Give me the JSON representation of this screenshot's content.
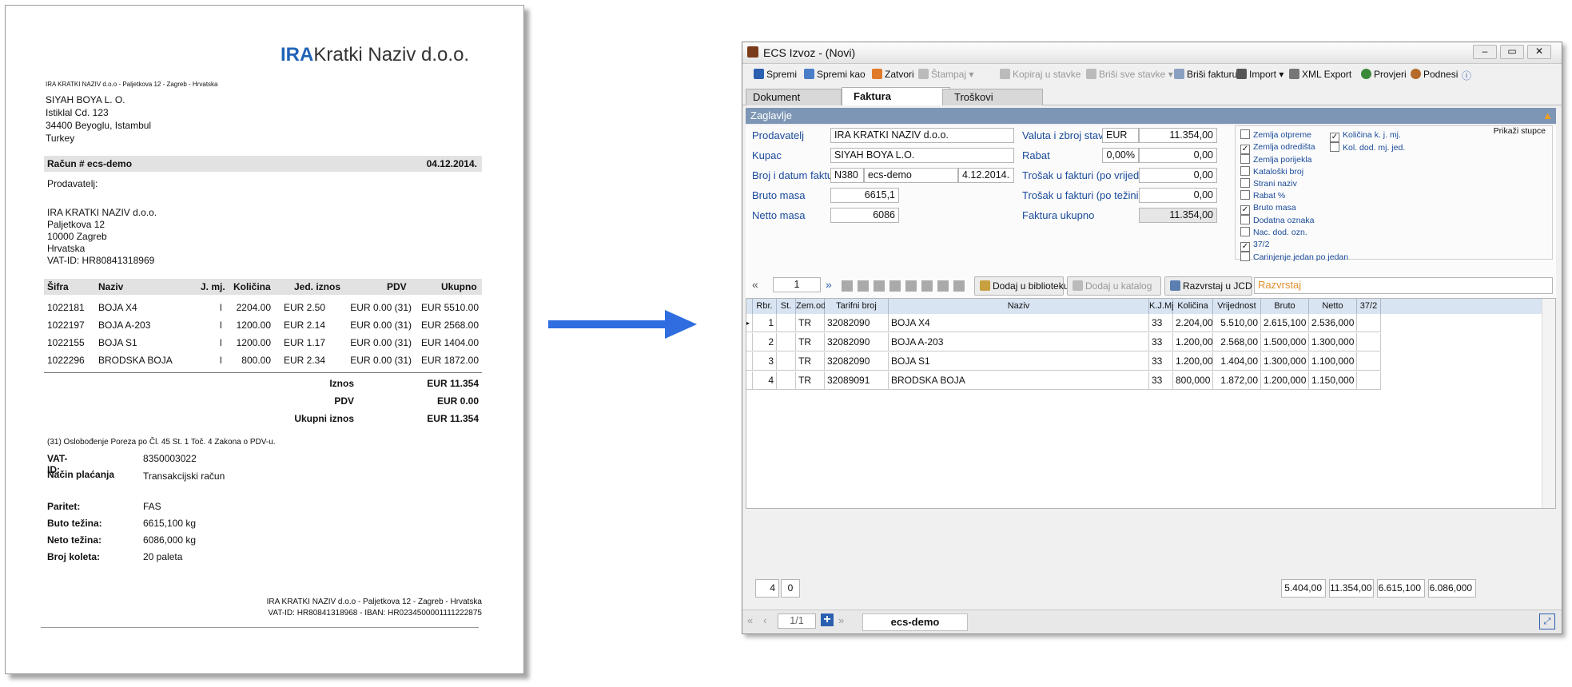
{
  "invoice": {
    "logo_bold": "IRA",
    "logo_rest": "Kratki Naziv d.o.o.",
    "sender_line": "IRA KRATKI NAZIV d.o.o - Paljetkova 12 - Zagreb - Hrvatska",
    "recipient": [
      "SIYAH BOYA L. O.",
      "Istiklal Cd. 123",
      "34400 Beyoglu, Istambul",
      "Turkey"
    ],
    "title": "Račun # ecs-demo",
    "date": "04.12.2014.",
    "seller_label": "Prodavatelj:",
    "seller": [
      "IRA KRATKI NAZIV d.o.o.",
      "Paljetkova 12",
      "10000 Zagreb",
      "Hrvatska",
      "VAT-ID: HR80841318969"
    ],
    "table_headers": [
      "Šifra",
      "Naziv",
      "J. mj.",
      "Količina",
      "Jed. iznos",
      "PDV",
      "Ukupno"
    ],
    "rows": [
      [
        "1022181",
        "BOJA X4",
        "l",
        "2204.00",
        "EUR 2.50",
        "EUR 0.00 (31)",
        "EUR 5510.00"
      ],
      [
        "1022197",
        "BOJA A-203",
        "l",
        "1200.00",
        "EUR 2.14",
        "EUR 0.00 (31)",
        "EUR 2568.00"
      ],
      [
        "1022155",
        "BOJA S1",
        "l",
        "1200.00",
        "EUR 1.17",
        "EUR 0.00 (31)",
        "EUR 1404.00"
      ],
      [
        "1022296",
        "BRODSKA BOJA",
        "l",
        "800.00",
        "EUR 2.34",
        "EUR 0.00 (31)",
        "EUR 1872.00"
      ]
    ],
    "totals": [
      {
        "label": "Iznos",
        "value": "EUR 11.354"
      },
      {
        "label": "PDV",
        "value": "EUR 0.00"
      },
      {
        "label": "Ukupni iznos",
        "value": "EUR 11.354"
      }
    ],
    "note": "(31) Oslobođenje Poreza po Čl. 45 St. 1 Toč. 4 Zakona o PDV-u.",
    "info1": [
      {
        "label": "VAT-ID:",
        "value": "8350003022"
      },
      {
        "label": "Način plaćanja",
        "value": "Transakcijski račun"
      }
    ],
    "info2": [
      {
        "label": "Paritet:",
        "value": "FAS"
      },
      {
        "label": "Buto težina:",
        "value": "6615,100 kg"
      },
      {
        "label": "Neto težina:",
        "value": "6086,000 kg"
      },
      {
        "label": "Broj koleta:",
        "value": "20 paleta"
      }
    ],
    "footer1": "IRA KRATKI NAZIV d.o.o - Paljetkova 12 - Zagreb - Hrvatska",
    "footer2": "VAT-ID: HR80841318968 - IBAN: HR0234500001111222875"
  },
  "window": {
    "title": "ECS Izvoz - (Novi)",
    "toolbar": {
      "save": "Spremi",
      "save_as": "Spremi kao",
      "close": "Zatvori",
      "print": "Štampaj",
      "copy_to_items": "Kopiraj u stavke",
      "delete_all": "Briši sve stavke",
      "delete_invoice": "Briši fakturu",
      "import": "Import",
      "xml_export": "XML Export",
      "check": "Provjeri",
      "submit": "Podnesi"
    },
    "tabs": [
      "Dokument",
      "Faktura",
      "Troškovi"
    ],
    "section_title": "Zaglavlje",
    "form": {
      "seller_label": "Prodavatelj",
      "seller_value": "IRA KRATKI NAZIV d.o.o.",
      "buyer_label": "Kupac",
      "buyer_value": "SIYAH BOYA L.O.",
      "number_label": "Broj i datum fakture",
      "number_prefix": "N380",
      "number_value": "ecs-demo",
      "date_value": "4.12.2014.",
      "gross_label": "Bruto masa",
      "gross_value": "6615,1",
      "net_label": "Netto masa",
      "net_value": "6086",
      "currency_label": "Valuta i zbroj stavki",
      "currency_value": "EUR",
      "sum_value": "11.354,00",
      "discount_label": "Rabat",
      "discount_pct": "0,00%",
      "discount_value": "0,00",
      "cost_value_label": "Trošak u fakturi (po vrijednosti)",
      "cost_value": "0,00",
      "cost_weight_label": "Trošak u fakturi (po težini)",
      "cost_weight": "0,00",
      "total_label": "Faktura ukupno",
      "total_value": "11.354,00"
    },
    "show_columns_title": "Prikaži stupce",
    "checkboxes_col1": [
      {
        "label": "Zemlja otpreme",
        "checked": ""
      },
      {
        "label": "Zemlja odredišta",
        "checked": "✓"
      },
      {
        "label": "Zemlja porijekla",
        "checked": ""
      },
      {
        "label": "Kataloški broj",
        "checked": ""
      },
      {
        "label": "Strani naziv",
        "checked": ""
      },
      {
        "label": "Rabat %",
        "checked": ""
      },
      {
        "label": "Bruto masa",
        "checked": "✓"
      },
      {
        "label": "Dodatna oznaka",
        "checked": ""
      },
      {
        "label": "Nac. dod. ozn.",
        "checked": ""
      },
      {
        "label": "37/2",
        "checked": "✓"
      },
      {
        "label": "Carinjenje jedan po jedan",
        "checked": ""
      }
    ],
    "checkboxes_col2": [
      {
        "label": "Količina k. j. mj.",
        "checked": "✓"
      },
      {
        "label": "Kol. dod. mj. jed.",
        "checked": ""
      }
    ],
    "grid_toolbar": {
      "page": "1",
      "add_library": "Dodaj u biblioteku",
      "add_catalog": "Dodaj u katalog",
      "classify": "Razvrstaj u JCD",
      "classify_field": "Razvrstaj"
    },
    "grid_headers": [
      "Rbr.",
      "St.",
      "Zem.odr.",
      "Tarifni broj",
      "Naziv",
      "K.J.Mj.",
      "Količina",
      "Vrijednost",
      "Bruto",
      "Netto",
      "37/2"
    ],
    "grid_rows": [
      [
        "1",
        "",
        "TR",
        "32082090",
        "BOJA X4",
        "33",
        "2.204,000",
        "5.510,00",
        "2.615,100",
        "2.536,000",
        ""
      ],
      [
        "2",
        "",
        "TR",
        "32082090",
        "BOJA A-203",
        "33",
        "1.200,000",
        "2.568,00",
        "1.500,000",
        "1.300,000",
        ""
      ],
      [
        "3",
        "",
        "TR",
        "32082090",
        "BOJA S1",
        "33",
        "1.200,000",
        "1.404,00",
        "1.300,000",
        "1.100,000",
        ""
      ],
      [
        "4",
        "",
        "TR",
        "32089091",
        "BRODSKA BOJA",
        "33",
        "800,000",
        "1.872,00",
        "1.200,000",
        "1.150,000",
        ""
      ]
    ],
    "summary": {
      "count": "4",
      "zero": "0",
      "qty": "5.404,00",
      "value": "11.354,00",
      "gross": "6.615,100",
      "net": "6.086,000"
    },
    "statusbar": {
      "page": "1/1",
      "tab": "ecs-demo"
    }
  },
  "colors": {
    "accent": "#1f63b8",
    "section": "#7d96b5",
    "arrow": "#2f6de0",
    "header_tab_active": "#ffffff"
  }
}
